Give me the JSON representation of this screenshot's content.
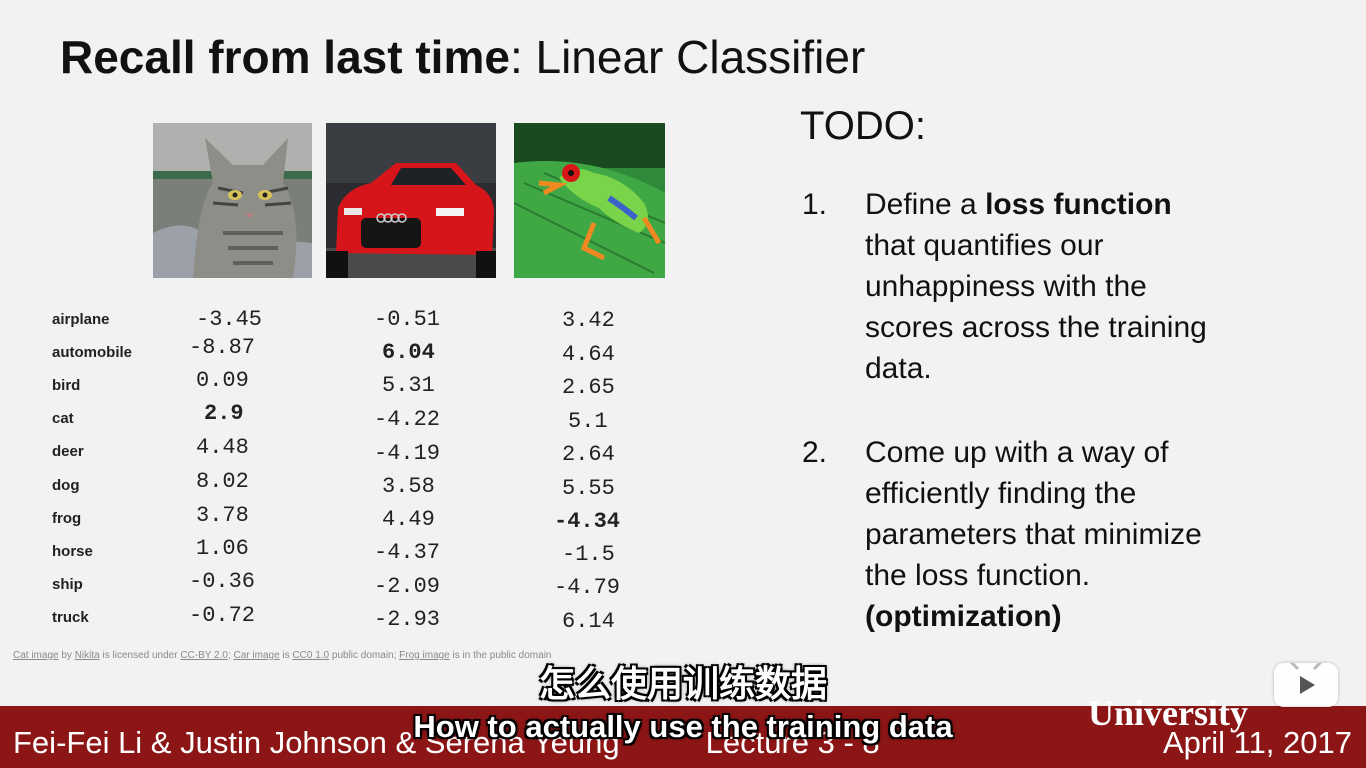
{
  "title": {
    "bold": "Recall from last time",
    "rest": ": Linear Classifier"
  },
  "classes": [
    "airplane",
    "automobile",
    "bird",
    "cat",
    "deer",
    "dog",
    "frog",
    "horse",
    "ship",
    "truck"
  ],
  "scores": {
    "cat": [
      "-3.45",
      "-8.87",
      "0.09",
      "2.9",
      "4.48",
      "8.02",
      "3.78",
      "1.06",
      "-0.36",
      "-0.72"
    ],
    "car": [
      "-0.51",
      "6.04",
      "5.31",
      "-4.22",
      "-4.19",
      "3.58",
      "4.49",
      "-4.37",
      "-2.09",
      "-2.93"
    ],
    "frog": [
      "3.42",
      "4.64",
      "2.65",
      "5.1",
      "2.64",
      "5.55",
      "-4.34",
      "-1.5",
      "-4.79",
      "6.14"
    ]
  },
  "credits": {
    "cat_image": "Cat image",
    "by": " by ",
    "nikita": "Nikita",
    "licensed": " is licensed under ",
    "cc_by": "CC-BY 2.0",
    "sep1": "; ",
    "car_image": "Car image",
    "is": " is ",
    "cc0": "CC0 1.0",
    "public1": " public domain; ",
    "frog_image": "Frog image",
    "public2": " is in the public domain"
  },
  "todo": {
    "heading": "TODO:",
    "item1": {
      "num": "1.",
      "line1_pre": "Define a ",
      "line1_bold": "loss function",
      "line2": "that quantifies our",
      "line3": "unhappiness with the",
      "line4": "scores across the training",
      "line5": "data."
    },
    "item2": {
      "num": "2.",
      "line1": "Come up with a way of",
      "line2": "efficiently finding the",
      "line3": "parameters that minimize",
      "line4": "the loss function.",
      "line5": "(optimization)"
    }
  },
  "footer": {
    "authors": "Fei-Fei Li & Justin Johnson & Serena Yeung",
    "lecture": "Lecture 3 - 8",
    "university": "University",
    "date": "April 11, 2017"
  },
  "subtitles": {
    "chinese": "怎么使用训练数据",
    "english": "How to actually use the training data"
  },
  "colors": {
    "footer_bg": "#8c1515"
  },
  "icons": {
    "play": "play-icon"
  }
}
